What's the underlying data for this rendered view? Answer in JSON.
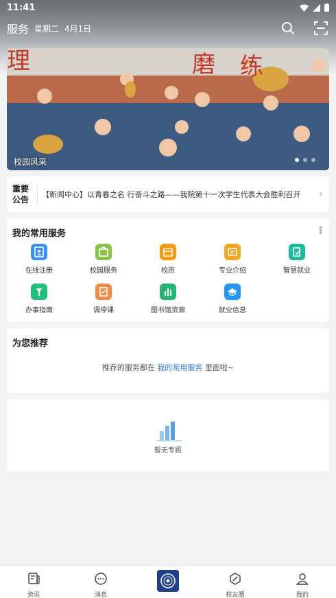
{
  "status": {
    "time": "11:41"
  },
  "header": {
    "title": "服务",
    "weekday": "星期二",
    "date": "4月1日"
  },
  "banner": {
    "caption": "校园风采",
    "slide_count": 3,
    "active_slide": 1
  },
  "notice": {
    "tag_line1": "重要",
    "tag_line2": "公告",
    "text": "【新闻中心】以青春之名  行奋斗之路——我院第十一次学生代表大会胜利召开"
  },
  "services": {
    "title": "我的常用服务",
    "items": [
      {
        "label": "在线注册",
        "icon": "register-icon",
        "color": "#3c8ef0"
      },
      {
        "label": "校园服务",
        "icon": "campus-service-icon",
        "color": "#8bc34a"
      },
      {
        "label": "校历",
        "icon": "calendar-icon",
        "color": "#f39c12"
      },
      {
        "label": "专业介绍",
        "icon": "major-intro-icon",
        "color": "#f5a623"
      },
      {
        "label": "智慧就业",
        "icon": "smart-job-icon",
        "color": "#1abc9c"
      },
      {
        "label": "办事指南",
        "icon": "guide-icon",
        "color": "#21c17a"
      },
      {
        "label": "调停课",
        "icon": "class-adjust-icon",
        "color": "#ef8b47"
      },
      {
        "label": "图书馆资源",
        "icon": "library-icon",
        "color": "#22b573"
      },
      {
        "label": "就业信息",
        "icon": "job-info-icon",
        "color": "#2196f3"
      }
    ]
  },
  "recommend": {
    "title": "为您推荐",
    "msg_before": "推荐的服务都在",
    "msg_link": "我的常用服务",
    "msg_after": "里面啦~"
  },
  "topics": {
    "empty_text": "暂无专题"
  },
  "tabbar": {
    "items": [
      {
        "label": "资讯",
        "icon": "news-icon"
      },
      {
        "label": "消息",
        "icon": "message-icon"
      },
      {
        "label": "",
        "icon": "school-logo-icon"
      },
      {
        "label": "校友圈",
        "icon": "alumni-icon"
      },
      {
        "label": "我的",
        "icon": "profile-icon"
      }
    ]
  }
}
